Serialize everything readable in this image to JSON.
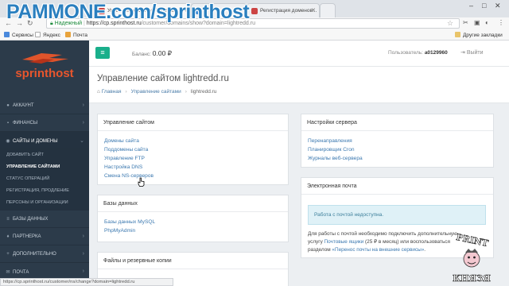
{
  "watermark": "PAMMONE.com/sprinthost",
  "browser": {
    "tabs": [
      {
        "title": "Управление сайтом lightredd..."
      },
      {
        "title": "Регистрация доменов..."
      },
      {
        "title": ""
      }
    ],
    "url": {
      "secure_label": "Надежный",
      "host": "https://cp.sprinthost.ru",
      "path": "/customer/domains/show?domain=lightredd.ru"
    },
    "bookmarks": [
      {
        "label": "Сервисы"
      },
      {
        "label": "Яндекс"
      },
      {
        "label": "Почта"
      }
    ],
    "other_bookmarks": "Другие закладки",
    "status_url": "https://cp.sprinthost.ru/customer/ns/change?domain=lightredd.ru"
  },
  "sidebar": {
    "logo_text": "sprinthost",
    "items": [
      {
        "label": "Аккаунт",
        "icon": "user-icon"
      },
      {
        "label": "Финансы",
        "icon": "finance-icon"
      },
      {
        "label": "Сайты и домены",
        "icon": "globe-icon"
      },
      {
        "label": "Базы данных",
        "icon": "database-icon"
      },
      {
        "label": "Партнерка",
        "icon": "partner-icon"
      },
      {
        "label": "Дополнительно",
        "icon": "plus-icon"
      },
      {
        "label": "Почта",
        "icon": "mail-icon"
      }
    ],
    "subitems": [
      {
        "label": "Добавить сайт"
      },
      {
        "label": "Управление сайтами"
      },
      {
        "label": "Статус операций"
      },
      {
        "label": "Регистрация, продление"
      },
      {
        "label": "Персоны и организации"
      }
    ]
  },
  "topbar": {
    "balance_label": "Баланс:",
    "balance_value": "0.00 ₽",
    "user_label": "Пользователь:",
    "user_value": "a0129960",
    "logout_label": "Выйти"
  },
  "page": {
    "title": "Управление сайтом lightredd.ru",
    "breadcrumb": [
      "Главная",
      "Управление сайтами",
      "lightredd.ru"
    ]
  },
  "panels": {
    "site": {
      "title": "Управление сайтом",
      "links": [
        "Домены сайта",
        "Поддомены сайта",
        "Управление FTP",
        "Настройка DNS",
        "Смена NS-серверов"
      ]
    },
    "databases": {
      "title": "Базы данных",
      "links": [
        "Базы данных MySQL",
        "PhpMyAdmin"
      ]
    },
    "files": {
      "title": "Файлы и резервные копии"
    },
    "server": {
      "title": "Настройки сервера",
      "links": [
        "Перенаправления",
        "Планировщик Cron",
        "Журналы веб-сервера"
      ]
    },
    "email": {
      "title": "Электронная почта",
      "alert": "Работа с почтой недоступна.",
      "text_1": "Для работы с почтой необходимо подключить дополнительную",
      "text_2a": "услугу ",
      "text_2_link": "Почтовые ящики",
      "text_2b": " (25 ₽ в месяц) или воспользоваться",
      "text_3a": "разделом ",
      "text_3_link": "«Перенос почты на внешние сервисы»",
      "text_3b": "."
    }
  },
  "mascot": {
    "top": "PRINT",
    "bottom": "КНЯЗЯ"
  }
}
